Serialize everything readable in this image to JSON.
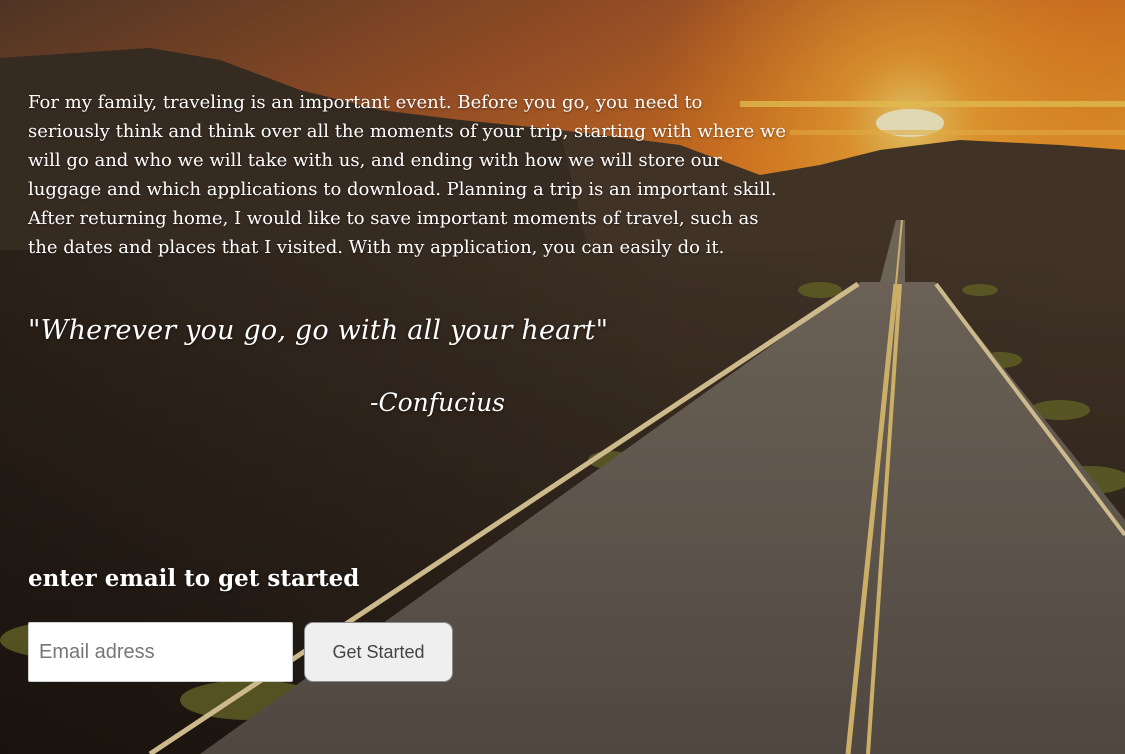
{
  "intro_text": "For my family, traveling is an important event. Before you go, you need to seriously think and think over all the moments of your trip, starting with where we will go and who we will take with us, and ending with how we will store our luggage and which applications to download. Planning a trip is an important skill. After returning home, I would like to save important moments of travel, such as the dates and places that I visited. With my application, you can easily do it.",
  "quote": {
    "text": "\"Wherever you go, go with all your heart\"",
    "author": "-Confucius"
  },
  "signup": {
    "heading": "enter email to get started",
    "email_placeholder": "Email adress",
    "button_label": "Get Started"
  },
  "colors": {
    "text": "#ffffff",
    "button_bg": "#efefef",
    "sky_orange": "#f08a2a",
    "sun": "#fff6cc"
  }
}
